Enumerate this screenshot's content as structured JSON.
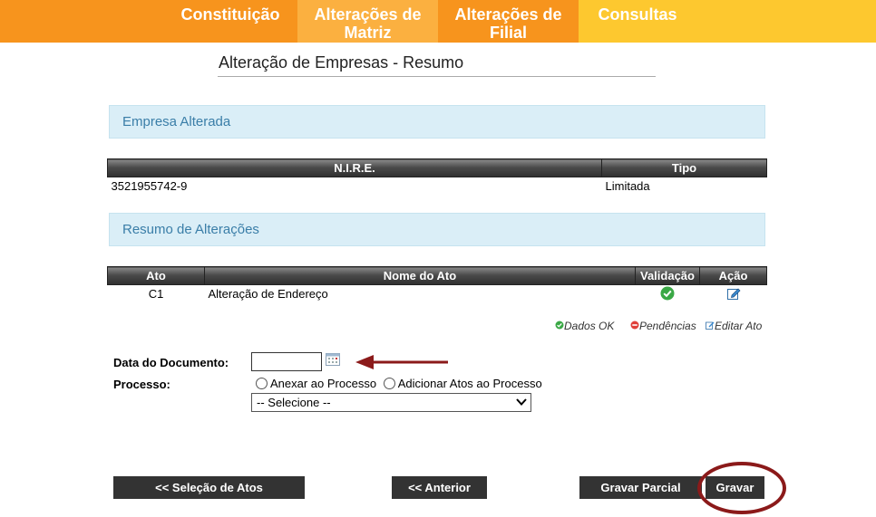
{
  "nav": {
    "tabs": [
      {
        "label": "Constituição"
      },
      {
        "label": "Alterações de\nMatriz"
      },
      {
        "label": "Alterações de\nFilial"
      },
      {
        "label": "Consultas"
      }
    ],
    "colors": {
      "orange": "#f7941d",
      "light_orange": "#fbb040",
      "yellow": "#fdc82f"
    }
  },
  "page_title": "Alteração de Empresas - Resumo",
  "empresa": {
    "section_title": "Empresa Alterada",
    "headers": {
      "nire": "N.I.R.E.",
      "tipo": "Tipo"
    },
    "row": {
      "nire": "3521955742-9",
      "tipo": "Limitada"
    }
  },
  "resumo": {
    "section_title": "Resumo de Alterações",
    "headers": {
      "ato": "Ato",
      "nome": "Nome do Ato",
      "validacao": "Validação",
      "acao": "Ação"
    },
    "rows": [
      {
        "ato": "C1",
        "nome": "Alteração de Endereço",
        "validacao_icon": "check-ok-icon",
        "acao_icon": "edit-icon"
      }
    ]
  },
  "legend": {
    "ok": "Dados OK",
    "pendencias": "Pendências",
    "editar": "Editar Ato"
  },
  "form": {
    "data_label": "Data do Documento:",
    "data_value": "",
    "processo_label": "Processo:",
    "radio_anexar": "Anexar ao Processo",
    "radio_adicionar": "Adicionar Atos ao Processo",
    "select_value": "-- Selecione --"
  },
  "buttons": {
    "selecao": "<< Seleção de Atos",
    "anterior": "<< Anterior",
    "gravar_parcial": "Gravar Parcial",
    "gravar": "Gravar"
  },
  "annotation_color": "#8b1a1a"
}
